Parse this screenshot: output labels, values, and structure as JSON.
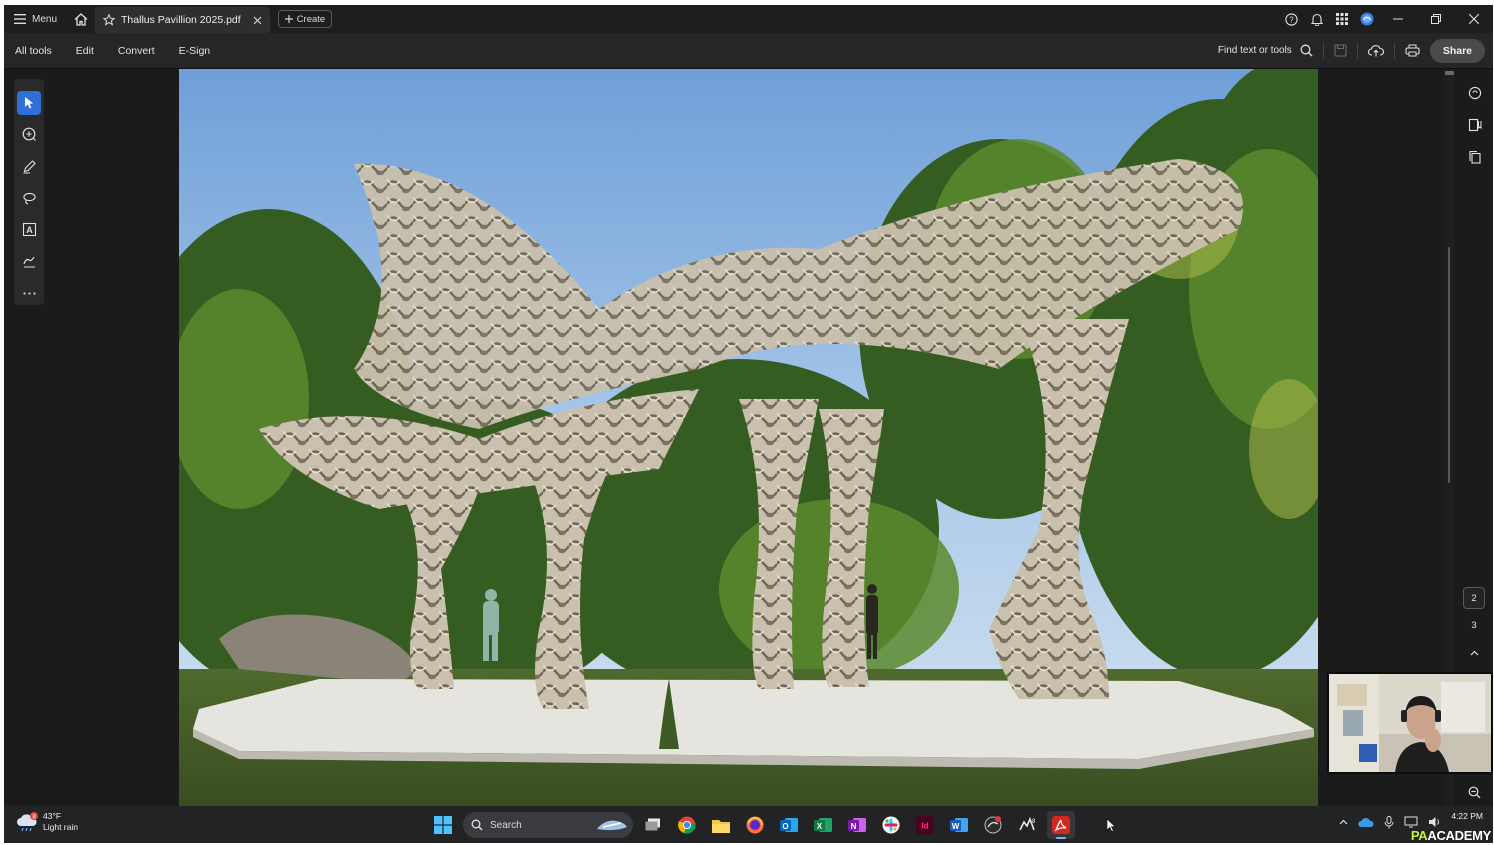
{
  "titlebar": {
    "menu_label": "Menu",
    "tab_title": "Thallus Pavillion 2025.pdf",
    "create_label": "Create"
  },
  "toolbar": {
    "items": [
      "All tools",
      "Edit",
      "Convert",
      "E-Sign"
    ],
    "find_label": "Find text or tools",
    "share_label": "Share"
  },
  "left_tools": [
    "select-icon",
    "comment-add-icon",
    "pen-icon",
    "lasso-icon",
    "text-box-icon",
    "sign-icon",
    "more-icon"
  ],
  "right_tools": [
    "comment-icon",
    "bookmark-icon",
    "pages-icon"
  ],
  "page_nav": {
    "current": "2",
    "next": "3"
  },
  "taskbar": {
    "weather_temp": "43°F",
    "weather_desc": "Light rain",
    "weather_badge": "8",
    "search_placeholder": "Search",
    "time": "4:22 PM",
    "watermark_a": "PA",
    "watermark_b": "ACADEMY"
  },
  "colors": {
    "accent": "#2f6fd8",
    "chrome": "#1b1b1b",
    "toolbar": "#262626"
  }
}
